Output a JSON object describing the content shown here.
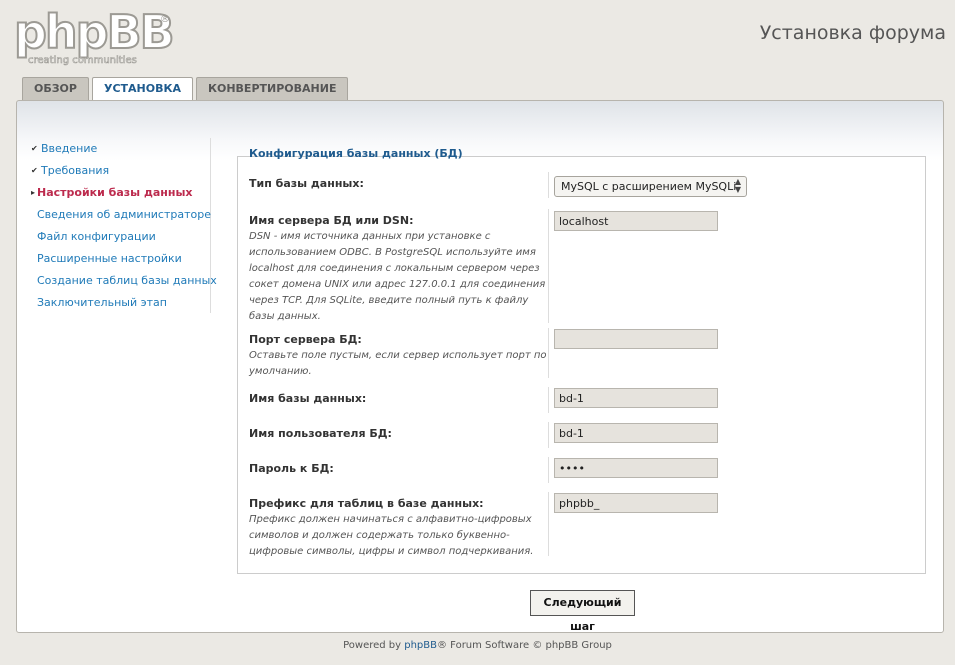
{
  "header": {
    "logo_text": "phpBB",
    "logo_tagline": "creating communities",
    "title": "Установка форума"
  },
  "tabs": [
    {
      "label": "ОБЗОР",
      "active": false
    },
    {
      "label": "УСТАНОВКА",
      "active": true
    },
    {
      "label": "КОНВЕРТИРОВАНИЕ",
      "active": false
    }
  ],
  "sidebar": {
    "items": [
      {
        "label": "Введение",
        "state": "done"
      },
      {
        "label": "Требования",
        "state": "done"
      },
      {
        "label": "Настройки базы данных",
        "state": "active"
      },
      {
        "label": "Сведения об администраторе",
        "state": "pending"
      },
      {
        "label": "Файл конфигурации",
        "state": "pending"
      },
      {
        "label": "Расширенные настройки",
        "state": "pending"
      },
      {
        "label": "Создание таблиц базы данных",
        "state": "pending"
      },
      {
        "label": "Заключительный этап",
        "state": "pending"
      }
    ]
  },
  "form": {
    "legend": "Конфигурация базы данных (БД)",
    "fields": {
      "dbms": {
        "label": "Тип базы данных:",
        "value": "MySQL с расширением MySQLi"
      },
      "dbhost": {
        "label": "Имя сервера БД или DSN:",
        "help": "DSN - имя источника данных при установке с использованием ODBC. В PostgreSQL используйте имя localhost для соединения с локальным сервером через сокет домена UNIX или адрес 127.0.0.1 для соединения через TCP. Для SQLite, введите полный путь к файлу базы данных.",
        "value": "localhost"
      },
      "dbport": {
        "label": "Порт сервера БД:",
        "help": "Оставьте поле пустым, если сервер использует порт по умолчанию.",
        "value": ""
      },
      "dbname": {
        "label": "Имя базы данных:",
        "value": "bd-1"
      },
      "dbuser": {
        "label": "Имя пользователя БД:",
        "value": "bd-1"
      },
      "dbpasswd": {
        "label": "Пароль к БД:",
        "value": "••••"
      },
      "table_prefix": {
        "label": "Префикс для таблиц в базе данных:",
        "help": "Префикс должен начинаться с алфавитно-цифровых символов и должен содержать только буквенно-цифровые символы, цифры и символ подчеркивания.",
        "value": "phpbb_"
      }
    },
    "submit_label": "Следующий шаг"
  },
  "footer": {
    "prefix": "Powered by ",
    "link": "phpBB",
    "suffix": "® Forum Software © phpBB Group"
  }
}
